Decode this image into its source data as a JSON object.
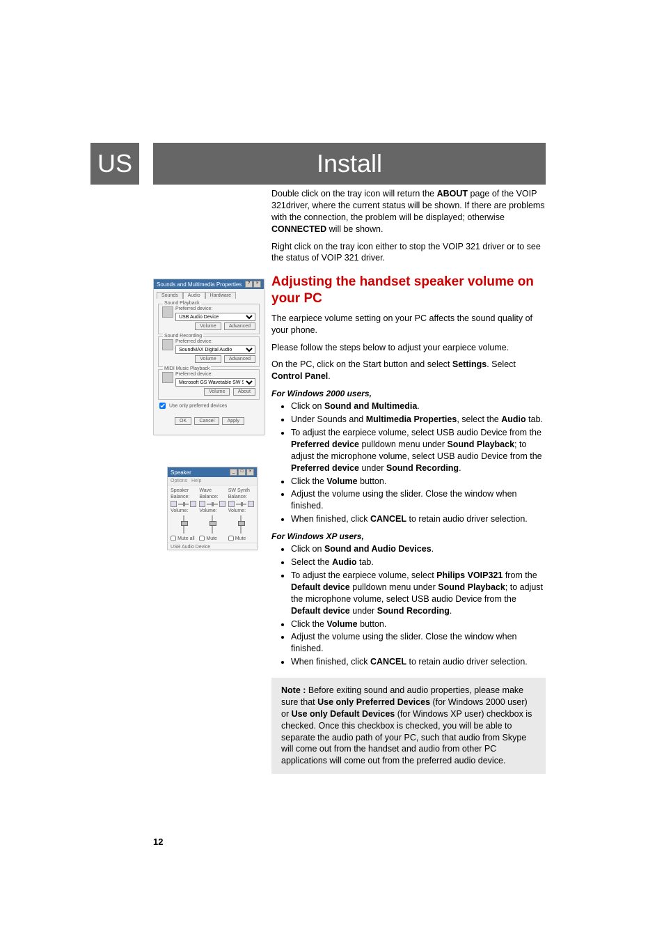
{
  "header": {
    "badge": "US",
    "title": "Install"
  },
  "intro": {
    "p1a": "Double click on the tray icon will return the ",
    "p1b": "ABOUT",
    "p1c": " page of the VOIP 321driver, where the current status will be shown.  If there are problems with the connection, the problem will be displayed; otherwise ",
    "p1d": "CONNECTED",
    "p1e": " will be shown.",
    "p2": "Right click on the tray icon either to stop the VOIP 321 driver or to see the status of VOIP 321 driver."
  },
  "section": {
    "heading": "Adjusting the handset speaker volume on your PC",
    "p1": "The earpiece volume setting on your PC affects the sound quality of your phone.",
    "p2": "Please follow the steps below to adjust your earpiece volume.",
    "p3a": "On the PC, click on the Start button and select ",
    "p3b": "Settings",
    "p3c": ". Select ",
    "p3d": "Control Panel",
    "p3e": "."
  },
  "win2000": {
    "label": "For Windows 2000 users,",
    "b1a": "Click on ",
    "b1b": "Sound and Multimedia",
    "b1c": ".",
    "b2a": "Under Sounds and ",
    "b2b": "Multimedia Properties",
    "b2c": ", select the ",
    "b2d": "Audio",
    "b2e": " tab.",
    "b3a": "To adjust the earpiece volume, select USB audio Device from the ",
    "b3b": "Preferred device",
    "b3c": " pulldown menu under ",
    "b3d": "Sound Playback",
    "b3e": "; to adjust the microphone volume, select USB audio Device from the ",
    "b3f": "Preferred device",
    "b3g": " under ",
    "b3h": "Sound Recording",
    "b3i": ".",
    "b4a": "Click the ",
    "b4b": "Volume",
    "b4c": " button.",
    "b5": "Adjust the volume using the slider.  Close the window when finished.",
    "b6a": "When finished, click ",
    "b6b": "CANCEL",
    "b6c": " to retain audio driver selection."
  },
  "winxp": {
    "label": "For Windows XP users,",
    "b1a": "Click on ",
    "b1b": "Sound and Audio Devices",
    "b1c": ".",
    "b2a": "Select the ",
    "b2b": "Audio",
    "b2c": " tab.",
    "b3a": "To adjust the earpiece volume, select ",
    "b3b": "Philips VOIP321",
    "b3c": " from the ",
    "b3d": "Default device",
    "b3e": " pulldown menu under ",
    "b3f": "Sound Playback",
    "b3g": "; to adjust the microphone volume, select USB audio Device from the ",
    "b3h": "Default device",
    "b3i": " under ",
    "b3j": "Sound Recording",
    "b3k": ".",
    "b4a": "Click the ",
    "b4b": "Volume",
    "b4c": " button.",
    "b5": "Adjust the volume using the slider. Close the window when finished.",
    "b6a": "When finished, click ",
    "b6b": "CANCEL",
    "b6c": " to retain audio driver selection."
  },
  "note": {
    "a": "Note : ",
    "b": "Before exiting sound and audio properties, please make sure that ",
    "c": "Use only Preferred Devices",
    "d": " (for Windows 2000 user) or ",
    "e": "Use only Default Devices",
    "f": " (for Windows XP user) checkbox is checked. Once this checkbox is checked, you will be able to separate the audio path of your PC, such that audio from Skype will come out from the handset and audio from other PC applications will come out from the preferred audio device."
  },
  "pagenum": "12",
  "dlg1": {
    "title": "Sounds and Multimedia Properties",
    "help": "?",
    "close": "×",
    "tabs": [
      "Sounds",
      "Audio",
      "Hardware"
    ],
    "grp_playback": "Sound Playback",
    "grp_recording": "Sound Recording",
    "grp_midi": "MIDI Music Playback",
    "pref_label": "Preferred device:",
    "playback_device": "USB Audio Device",
    "recording_device": "SoundMAX Digital Audio",
    "midi_device": "Microsoft GS Wavetable SW Synth",
    "btn_volume": "Volume",
    "btn_advanced": "Advanced",
    "btn_about": "About",
    "chk": "Use only preferred devices",
    "ok": "OK",
    "cancel": "Cancel",
    "apply": "Apply"
  },
  "dlg2": {
    "title": "Speaker",
    "min": "_",
    "max": "□",
    "close": "×",
    "menu_options": "Options",
    "menu_help": "Help",
    "cols": [
      {
        "hdr": "Speaker",
        "bal": "Balance:",
        "vol": "Volume:",
        "mute": "Mute all"
      },
      {
        "hdr": "Wave",
        "bal": "Balance:",
        "vol": "Volume:",
        "mute": "Mute"
      },
      {
        "hdr": "SW Synth",
        "bal": "Balance:",
        "vol": "Volume:",
        "mute": "Mute"
      }
    ],
    "footer": "USB Audio Device"
  }
}
